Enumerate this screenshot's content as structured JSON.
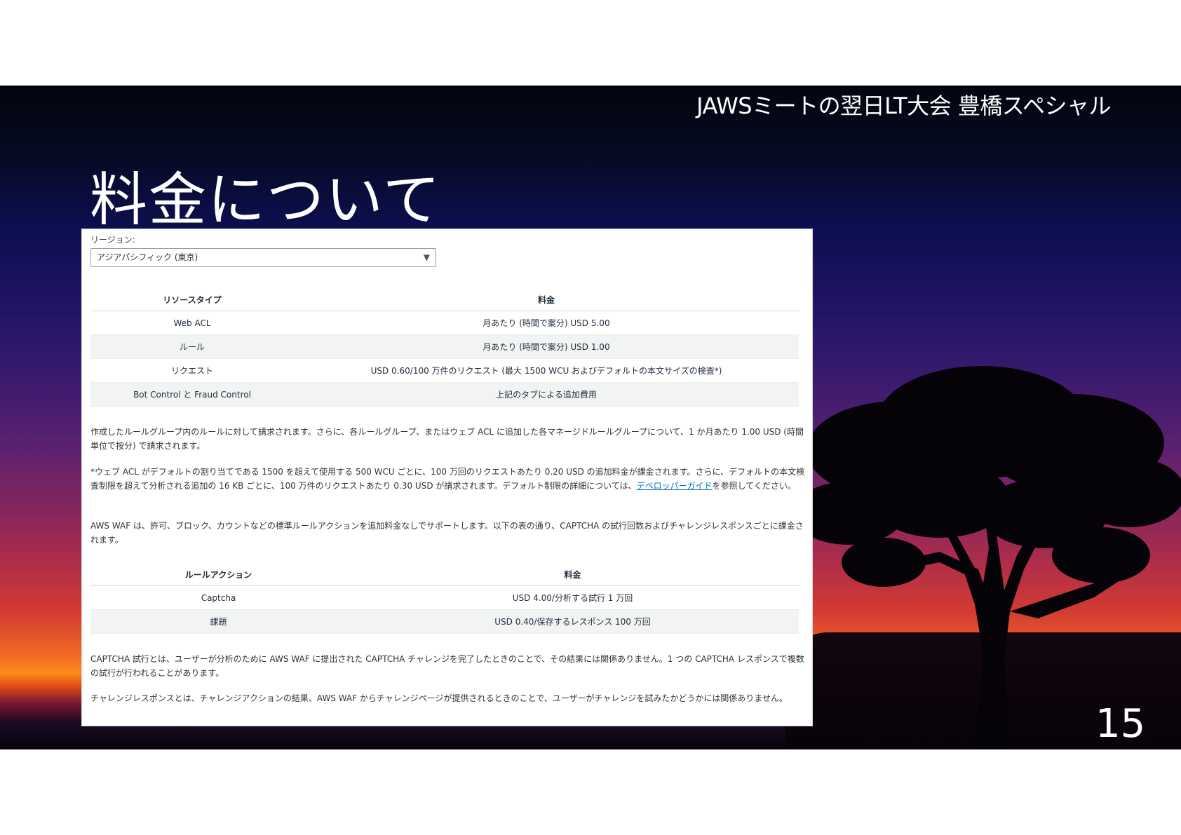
{
  "header": {
    "event_title": "JAWSミートの翌日LT大会 豊橋スペシャル"
  },
  "slide": {
    "title": "料金について",
    "page_number": "15"
  },
  "region": {
    "label": "リージョン:",
    "selected": "アジアパシフィック (東京)"
  },
  "pricing_table": {
    "headers": [
      "リソースタイプ",
      "料金"
    ],
    "rows": [
      [
        "Web ACL",
        "月あたり (時間で案分) USD 5.00"
      ],
      [
        "ルール",
        "月あたり (時間で案分) USD 1.00"
      ],
      [
        "リクエスト",
        "USD 0.60/100 万件のリクエスト (最大 1500 WCU およびデフォルトの本文サイズの検査*)"
      ],
      [
        "Bot Control と Fraud Control",
        "上記のタブによる追加費用"
      ]
    ]
  },
  "paragraphs": {
    "p1": "作成したルールグループ内のルールに対して請求されます。さらに、各ルールグループ、またはウェブ ACL に追加した各マネージドルールグループについて、1 か月あたり 1.00 USD (時間単位で按分) で請求されます。",
    "p2_before_link": "*ウェブ ACL がデフォルトの割り当てである 1500 を超えて使用する 500 WCU ごとに、100 万回のリクエストあたり 0.20 USD の追加料金が課金されます。さらに、デフォルトの本文検査制限を超えて分析される追加の 16 KB ごとに、100 万件のリクエストあたり 0.30 USD が請求されます。デフォルト制限の詳細については、",
    "p2_link": "デベロッパーガイド",
    "p2_after_link": "を参照してください。",
    "p3": "AWS WAF は、許可、ブロック、カウントなどの標準ルールアクションを追加料金なしでサポートします。以下の表の通り、CAPTCHA の試行回数およびチャレンジレスポンスごとに課金されます。",
    "p4": "CAPTCHA 試行とは、ユーザーが分析のために AWS WAF に提出された CAPTCHA チャレンジを完了したときのことで、その結果には関係ありません。1 つの CAPTCHA レスポンスで複数の試行が行われることがあります。",
    "p5": "チャレンジレスポンスとは、チャレンジアクションの結果、AWS WAF からチャレンジページが提供されるときのことで、ユーザーがチャレンジを試みたかどうかには関係ありません。"
  },
  "action_table": {
    "headers": [
      "ルールアクション",
      "料金"
    ],
    "rows": [
      [
        "Captcha",
        "USD 4.00/分析する試行 1 万回"
      ],
      [
        "課題",
        "USD 0.40/保存するレスポンス 100 万回"
      ]
    ]
  }
}
